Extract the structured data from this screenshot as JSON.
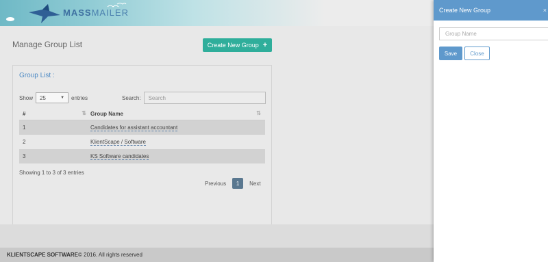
{
  "brand": {
    "logo_bold": "MASS",
    "logo_thin": "MAILER"
  },
  "page": {
    "title": "Manage Group List",
    "create_button": "Create New Group",
    "create_icon": "+"
  },
  "panel": {
    "title": "Group List :",
    "show_label": "Show",
    "show_value": "25",
    "entries_label": "entries",
    "search_label": "Search:",
    "search_placeholder": "Search",
    "columns": [
      "#",
      "Group Name"
    ],
    "rows": [
      {
        "num": "1",
        "name": "Candidates for assistant accountant"
      },
      {
        "num": "2",
        "name": "KlientScape / Software"
      },
      {
        "num": "3",
        "name": "KS Software candidates"
      }
    ],
    "info": "Showing 1 to 3 of 3 entries",
    "pager": {
      "previous": "Previous",
      "current": "1",
      "next": "Next"
    }
  },
  "footer": {
    "company": "KLIENTSCAPE SOFTWARE",
    "rights": " © 2016. All rights reserved"
  },
  "drawer": {
    "title": "Create New Group",
    "close_icon": "×",
    "input_placeholder": "Group Name",
    "save_label": "Save",
    "close_label": "Close"
  }
}
